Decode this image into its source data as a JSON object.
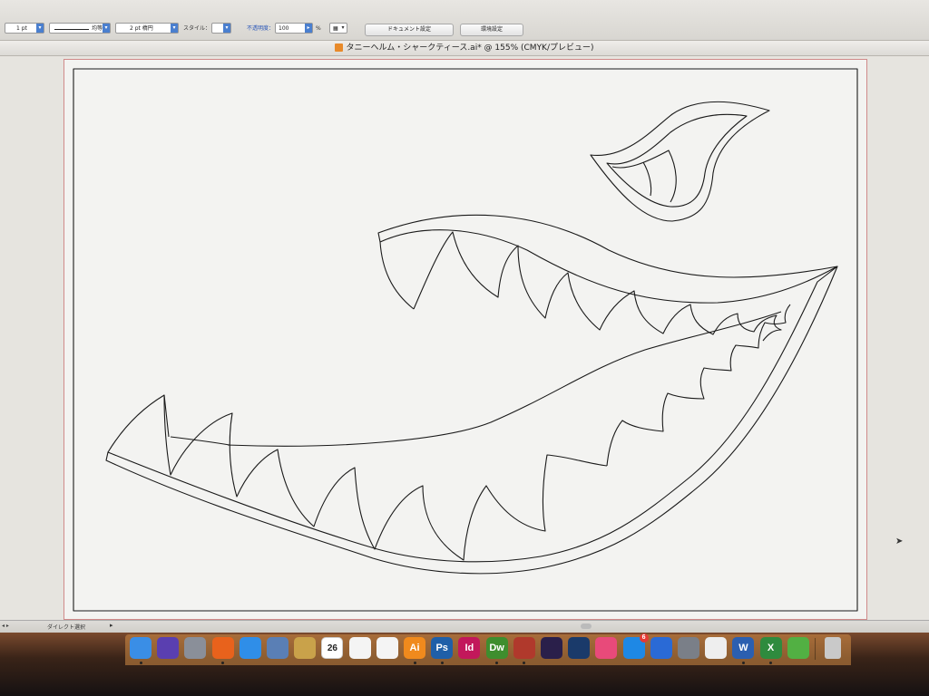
{
  "control_bar": {
    "stroke_weight": "1 pt",
    "stroke_profile": "均等",
    "brush": "2 pt 楕円",
    "style_label": "スタイル：",
    "opacity_label": "不透明度：",
    "opacity_value": "100",
    "opacity_unit": "%",
    "document_setup_button": "ドキュメント設定",
    "preferences_button": "環境設定"
  },
  "document": {
    "title": "タニーヘルム・シャークティース.ai* @ 155% (CMYK/プレビュー)"
  },
  "status_bar": {
    "tool_name": "ダイレクト選択",
    "nav_arrows": "◂ ▸"
  },
  "dock": {
    "items": [
      {
        "name": "finder",
        "label": "",
        "color": "#3a8ee6"
      },
      {
        "name": "siri",
        "label": "",
        "color": "#5a3fb0"
      },
      {
        "name": "launchpad",
        "label": "",
        "color": "#8a8f99"
      },
      {
        "name": "firefox",
        "label": "",
        "color": "#e8621c"
      },
      {
        "name": "safari",
        "label": "",
        "color": "#2f8ee8"
      },
      {
        "name": "preview",
        "label": "",
        "color": "#5a7fb5"
      },
      {
        "name": "notes",
        "label": "",
        "color": "#c9a24a"
      },
      {
        "name": "calendar",
        "label": "26",
        "color": "#ffffff"
      },
      {
        "name": "photos",
        "label": "",
        "color": "#f4f4f4"
      },
      {
        "name": "acrobat",
        "label": "",
        "color": "#f4f4f4"
      },
      {
        "name": "illustrator",
        "label": "Ai",
        "color": "#f08a1d"
      },
      {
        "name": "photoshop",
        "label": "Ps",
        "color": "#1f5fa8"
      },
      {
        "name": "indesign",
        "label": "Id",
        "color": "#c2185b"
      },
      {
        "name": "dreamweaver",
        "label": "Dw",
        "color": "#3e8e2e"
      },
      {
        "name": "photo-booth",
        "label": "",
        "color": "#b0392c"
      },
      {
        "name": "premiere-rush",
        "label": "",
        "color": "#2a1f4a"
      },
      {
        "name": "quicktime",
        "label": "",
        "color": "#1a3a6a"
      },
      {
        "name": "itunes",
        "label": "",
        "color": "#e84a7a"
      },
      {
        "name": "app-store",
        "label": "",
        "color": "#1e88e5"
      },
      {
        "name": "dropbox",
        "label": "",
        "color": "#2a6ad6"
      },
      {
        "name": "system-preferences",
        "label": "",
        "color": "#7a7f88"
      },
      {
        "name": "document",
        "label": "",
        "color": "#eeeeee"
      },
      {
        "name": "word",
        "label": "W",
        "color": "#2b5fb0"
      },
      {
        "name": "excel",
        "label": "X",
        "color": "#2e8b3e"
      },
      {
        "name": "evernote",
        "label": "",
        "color": "#52b043"
      },
      {
        "name": "trash",
        "label": "",
        "color": "#c9c9c9"
      }
    ],
    "badge_app_store": "6"
  },
  "colors": {
    "artboard_border": "#d08a8a",
    "accent_blue": "#4a7fcf",
    "illustrator_orange": "#f08a1d"
  }
}
